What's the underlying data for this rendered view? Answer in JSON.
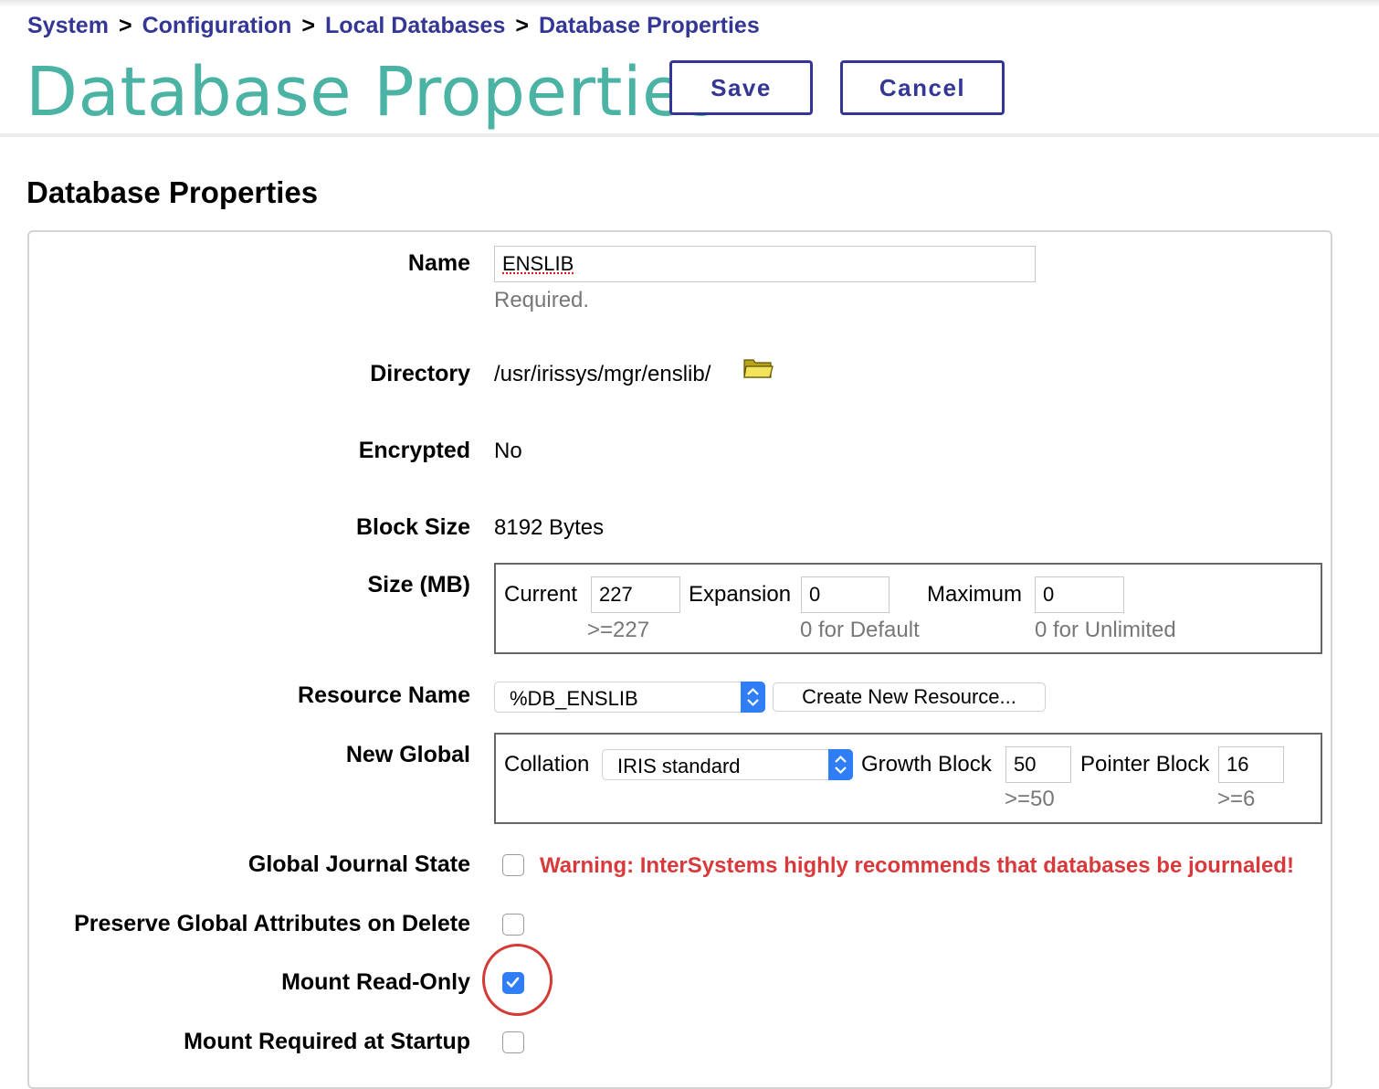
{
  "breadcrumb": {
    "items": [
      "System",
      "Configuration",
      "Local Databases",
      "Database Properties"
    ],
    "separator": ">"
  },
  "header": {
    "title": "Database Properties",
    "save_label": "Save",
    "cancel_label": "Cancel"
  },
  "section_title": "Database Properties",
  "form": {
    "name": {
      "label": "Name",
      "value": "ENSLIB",
      "hint": "Required."
    },
    "directory": {
      "label": "Directory",
      "value": "/usr/irissys/mgr/enslib/",
      "icon": "folder-icon"
    },
    "encrypted": {
      "label": "Encrypted",
      "value": "No"
    },
    "block_size": {
      "label": "Block Size",
      "value": "8192 Bytes"
    },
    "size": {
      "label": "Size (MB)",
      "current_label": "Current",
      "current_value": "227",
      "current_hint": ">=227",
      "expansion_label": "Expansion",
      "expansion_value": "0",
      "expansion_hint": "0 for Default",
      "maximum_label": "Maximum",
      "maximum_value": "0",
      "maximum_hint": "0 for Unlimited"
    },
    "resource": {
      "label": "Resource Name",
      "selected": "%DB_ENSLIB",
      "create_button": "Create New Resource..."
    },
    "new_global": {
      "label": "New Global",
      "collation_label": "Collation",
      "collation_selected": "IRIS standard",
      "growth_label": "Growth Block",
      "growth_value": "50",
      "growth_hint": ">=50",
      "pointer_label": "Pointer Block",
      "pointer_value": "16",
      "pointer_hint": ">=6"
    },
    "journal": {
      "label": "Global Journal State",
      "checked": false,
      "warning": "Warning: InterSystems highly recommends that databases be journaled!"
    },
    "preserve": {
      "label": "Preserve Global Attributes on Delete",
      "checked": false
    },
    "read_only": {
      "label": "Mount Read-Only",
      "checked": true
    },
    "required_startup": {
      "label": "Mount Required at Startup",
      "checked": false
    }
  },
  "colors": {
    "accent": "#333695",
    "title": "#4bb3a4",
    "warning": "#d9393b",
    "checkbox": "#2f7ef6",
    "highlight_circle": "#d33b34"
  }
}
